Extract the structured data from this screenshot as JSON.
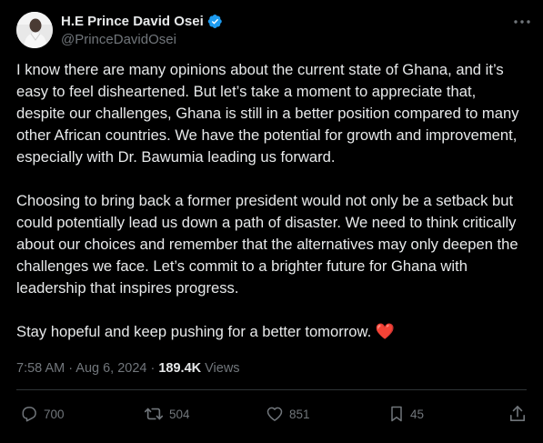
{
  "author": {
    "display_name": "H.E Prince David Osei",
    "handle": "@PrinceDavidOsei",
    "verified": true,
    "avatar_icon": "profile-photo"
  },
  "tweet": {
    "paragraphs": [
      "I know there are many opinions about the current state of Ghana, and it’s easy to feel disheartened. But let’s take a moment to appreciate that, despite our challenges, Ghana is still in a better position compared to many other African countries. We have the potential for growth and improvement, especially with Dr. Bawumia leading us forward.",
      "Choosing to bring back a former president would not only be a setback but could potentially lead us down a path of disaster. We need to think critically about our choices and remember that the alternatives may only deepen the challenges we face. Let’s commit to a brighter future for Ghana with leadership that inspires progress.",
      "Stay hopeful and keep pushing for a better tomorrow."
    ],
    "emoji": "❤️",
    "timestamp": "7:58 AM · Aug 6, 2024",
    "separator": "·",
    "views_count": "189.4K",
    "views_label": "Views"
  },
  "actions": {
    "reply": {
      "icon": "reply-icon",
      "count": "700"
    },
    "repost": {
      "icon": "repost-icon",
      "count": "504"
    },
    "like": {
      "icon": "like-icon",
      "count": "851"
    },
    "bookmark": {
      "icon": "bookmark-icon",
      "count": "45"
    },
    "share": {
      "icon": "share-icon"
    }
  },
  "colors": {
    "background": "#000000",
    "text": "#e7e9ea",
    "muted": "#71767b",
    "verified": "#1d9bf0",
    "heart": "#f91880",
    "divider": "#2f3336"
  }
}
